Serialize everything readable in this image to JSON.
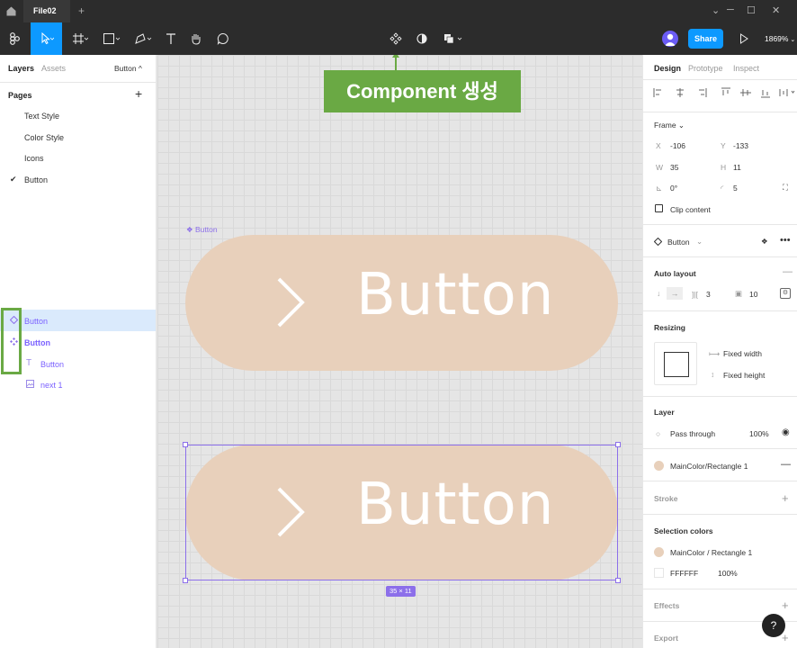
{
  "titlebar": {
    "file_tab": "File02",
    "add_tab": "+",
    "window_minimize": "⌄",
    "window_restore": "─",
    "window_max": "☐",
    "window_close": "✕"
  },
  "toolbar": {
    "share": "Share",
    "zoom": "1869%"
  },
  "left": {
    "tab_layers": "Layers",
    "tab_assets": "Assets",
    "page_selector": "Button ^",
    "pages_header": "Pages",
    "add_page": "+",
    "pages": [
      "Text Style",
      "Color Style",
      "Icons",
      "Button"
    ],
    "layers": [
      "Button",
      "Button",
      "Button",
      "next 1"
    ]
  },
  "canvas": {
    "annotation": "Component 생성",
    "frame_label": "Button",
    "button_text_1": "Button",
    "button_text_2": "Button",
    "size_badge": "35 × 11"
  },
  "right": {
    "tab_design": "Design",
    "tab_prototype": "Prototype",
    "tab_inspect": "Inspect",
    "frame_header": "Frame ⌄",
    "x_label": "X",
    "x_value": "-106",
    "y_label": "Y",
    "y_value": "-133",
    "w_label": "W",
    "w_value": "35",
    "h_label": "H",
    "h_value": "11",
    "rotation": "0°",
    "radius": "5",
    "clip_content": "Clip content",
    "component_name": "Button",
    "auto_layout": "Auto layout",
    "gap": "3",
    "padding": "10",
    "resizing": "Resizing",
    "fixed_width": "Fixed width",
    "fixed_height": "Fixed height",
    "layer": "Layer",
    "blend": "Pass through",
    "opacity": "100%",
    "fill_name": "MainColor/Rectangle 1",
    "stroke": "Stroke",
    "selection_colors": "Selection colors",
    "sel_color_1": "MainColor / Rectangle 1",
    "sel_color_2": "FFFFFF",
    "sel_color_2_opacity": "100%",
    "effects": "Effects",
    "export": "Export",
    "help": "?"
  },
  "colors": {
    "accent": "#0d99ff",
    "purple": "#8c6fea",
    "green": "#6aa944",
    "pill": "#e8d0bb"
  }
}
